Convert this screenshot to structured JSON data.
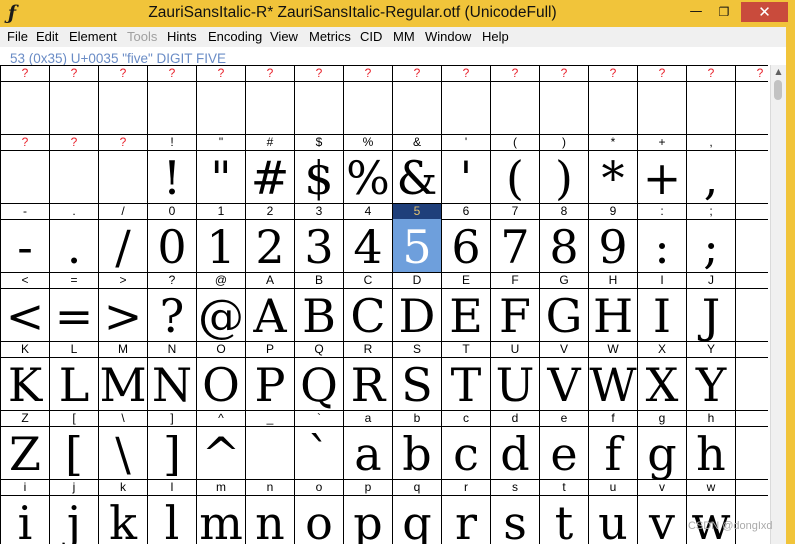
{
  "window": {
    "title": "ZauriSansItalic-R*  ZauriSansItalic-Regular.otf (UnicodeFull)",
    "app_icon_glyph": "ƒ",
    "minimize_glyph": "—",
    "maximize_glyph": "❐",
    "close_glyph": "✕"
  },
  "menu": [
    {
      "label": "File",
      "disabled": false
    },
    {
      "label": "Edit",
      "disabled": false
    },
    {
      "label": "Element",
      "disabled": false
    },
    {
      "label": "Tools",
      "disabled": true
    },
    {
      "label": "Hints",
      "disabled": false
    },
    {
      "label": "Encoding",
      "disabled": false
    },
    {
      "label": "View",
      "disabled": false
    },
    {
      "label": "Metrics",
      "disabled": false
    },
    {
      "label": "CID",
      "disabled": false
    },
    {
      "label": "MM",
      "disabled": false
    },
    {
      "label": "Window",
      "disabled": false
    },
    {
      "label": "Help",
      "disabled": false
    }
  ],
  "info": {
    "text": "53 (0x35) U+0035 \"five\" DIGIT FIVE"
  },
  "selected_cell": {
    "row": 2,
    "col": 8
  },
  "rows": [
    {
      "labels": [
        "?",
        "?",
        "?",
        "?",
        "?",
        "?",
        "?",
        "?",
        "?",
        "?",
        "?",
        "?",
        "?",
        "?",
        "?",
        "?"
      ],
      "glyphs": [
        "",
        "",
        "",
        "",
        "",
        "",
        "",
        "",
        "",
        "",
        "",
        "",
        "",
        "",
        "",
        ""
      ],
      "unknown": true
    },
    {
      "labels": [
        "?",
        "?",
        "?",
        "!",
        "\"",
        "#",
        "$",
        "%",
        "&",
        "'",
        "(",
        ")",
        "*",
        "+",
        ",",
        ""
      ],
      "glyphs": [
        "",
        "",
        "",
        "!",
        "\"",
        "#",
        "$",
        "%",
        "&",
        "'",
        "(",
        ")",
        "*",
        "+",
        ",",
        ""
      ],
      "unknown_cols": [
        0,
        1,
        2
      ]
    },
    {
      "labels": [
        "-",
        ".",
        "/",
        "0",
        "1",
        "2",
        "3",
        "4",
        "5",
        "6",
        "7",
        "8",
        "9",
        ":",
        ";",
        ""
      ],
      "glyphs": [
        "-",
        ".",
        "/",
        "0",
        "1",
        "2",
        "3",
        "4",
        "5",
        "6",
        "7",
        "8",
        "9",
        ":",
        ";",
        ""
      ]
    },
    {
      "labels": [
        "<",
        "=",
        ">",
        "?",
        "@",
        "A",
        "B",
        "C",
        "D",
        "E",
        "F",
        "G",
        "H",
        "I",
        "J",
        ""
      ],
      "glyphs": [
        "<",
        "=",
        ">",
        "?",
        "@",
        "A",
        "B",
        "C",
        "D",
        "E",
        "F",
        "G",
        "H",
        "I",
        "J",
        ""
      ]
    },
    {
      "labels": [
        "K",
        "L",
        "M",
        "N",
        "O",
        "P",
        "Q",
        "R",
        "S",
        "T",
        "U",
        "V",
        "W",
        "X",
        "Y",
        ""
      ],
      "glyphs": [
        "K",
        "L",
        "M",
        "N",
        "O",
        "P",
        "Q",
        "R",
        "S",
        "T",
        "U",
        "V",
        "W",
        "X",
        "Y",
        ""
      ]
    },
    {
      "labels": [
        "Z",
        "[",
        "\\",
        "]",
        "^",
        "_",
        "`",
        "a",
        "b",
        "c",
        "d",
        "e",
        "f",
        "g",
        "h",
        ""
      ],
      "glyphs": [
        "Z",
        "[",
        "\\",
        "]",
        "^",
        "_",
        "`",
        "a",
        "b",
        "c",
        "d",
        "e",
        "f",
        "g",
        "h",
        ""
      ]
    },
    {
      "labels": [
        "i",
        "j",
        "k",
        "l",
        "m",
        "n",
        "o",
        "p",
        "q",
        "r",
        "s",
        "t",
        "u",
        "v",
        "w",
        ""
      ],
      "glyphs": [
        "i",
        "j",
        "k",
        "l",
        "m",
        "n",
        "o",
        "p",
        "q",
        "r",
        "s",
        "t",
        "u",
        "v",
        "w",
        ""
      ]
    }
  ],
  "watermark": "CSDN @dongIxd",
  "colors": {
    "titlebar": "#f1c43a",
    "unknown_label": "#e8202a",
    "info_text": "#6a8cc6",
    "selected_label_bg": "#1f3f7a",
    "selected_glyph_bg": "#6e9fdc"
  }
}
